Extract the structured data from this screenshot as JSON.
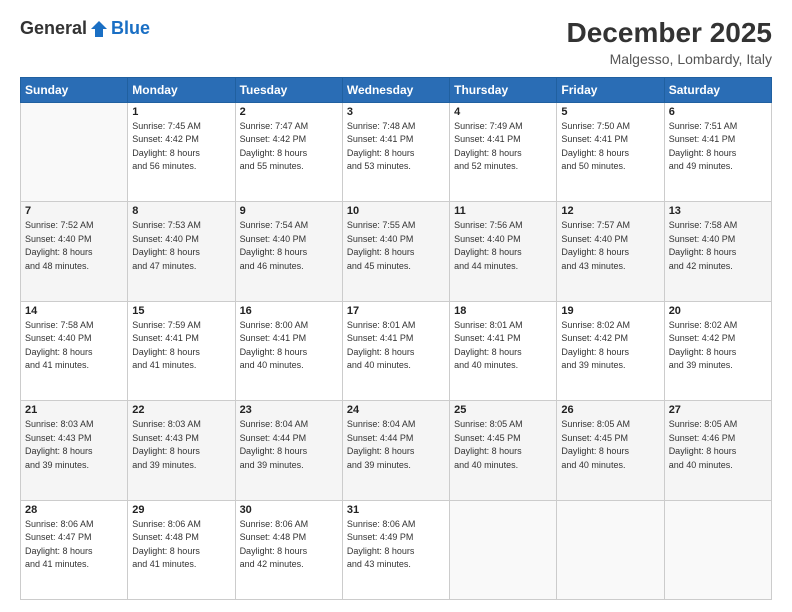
{
  "header": {
    "logo_general": "General",
    "logo_blue": "Blue",
    "month": "December 2025",
    "location": "Malgesso, Lombardy, Italy"
  },
  "days_of_week": [
    "Sunday",
    "Monday",
    "Tuesday",
    "Wednesday",
    "Thursday",
    "Friday",
    "Saturday"
  ],
  "weeks": [
    [
      {
        "day": "",
        "info": ""
      },
      {
        "day": "1",
        "info": "Sunrise: 7:45 AM\nSunset: 4:42 PM\nDaylight: 8 hours\nand 56 minutes."
      },
      {
        "day": "2",
        "info": "Sunrise: 7:47 AM\nSunset: 4:42 PM\nDaylight: 8 hours\nand 55 minutes."
      },
      {
        "day": "3",
        "info": "Sunrise: 7:48 AM\nSunset: 4:41 PM\nDaylight: 8 hours\nand 53 minutes."
      },
      {
        "day": "4",
        "info": "Sunrise: 7:49 AM\nSunset: 4:41 PM\nDaylight: 8 hours\nand 52 minutes."
      },
      {
        "day": "5",
        "info": "Sunrise: 7:50 AM\nSunset: 4:41 PM\nDaylight: 8 hours\nand 50 minutes."
      },
      {
        "day": "6",
        "info": "Sunrise: 7:51 AM\nSunset: 4:41 PM\nDaylight: 8 hours\nand 49 minutes."
      }
    ],
    [
      {
        "day": "7",
        "info": "Sunrise: 7:52 AM\nSunset: 4:40 PM\nDaylight: 8 hours\nand 48 minutes."
      },
      {
        "day": "8",
        "info": "Sunrise: 7:53 AM\nSunset: 4:40 PM\nDaylight: 8 hours\nand 47 minutes."
      },
      {
        "day": "9",
        "info": "Sunrise: 7:54 AM\nSunset: 4:40 PM\nDaylight: 8 hours\nand 46 minutes."
      },
      {
        "day": "10",
        "info": "Sunrise: 7:55 AM\nSunset: 4:40 PM\nDaylight: 8 hours\nand 45 minutes."
      },
      {
        "day": "11",
        "info": "Sunrise: 7:56 AM\nSunset: 4:40 PM\nDaylight: 8 hours\nand 44 minutes."
      },
      {
        "day": "12",
        "info": "Sunrise: 7:57 AM\nSunset: 4:40 PM\nDaylight: 8 hours\nand 43 minutes."
      },
      {
        "day": "13",
        "info": "Sunrise: 7:58 AM\nSunset: 4:40 PM\nDaylight: 8 hours\nand 42 minutes."
      }
    ],
    [
      {
        "day": "14",
        "info": "Sunrise: 7:58 AM\nSunset: 4:40 PM\nDaylight: 8 hours\nand 41 minutes."
      },
      {
        "day": "15",
        "info": "Sunrise: 7:59 AM\nSunset: 4:41 PM\nDaylight: 8 hours\nand 41 minutes."
      },
      {
        "day": "16",
        "info": "Sunrise: 8:00 AM\nSunset: 4:41 PM\nDaylight: 8 hours\nand 40 minutes."
      },
      {
        "day": "17",
        "info": "Sunrise: 8:01 AM\nSunset: 4:41 PM\nDaylight: 8 hours\nand 40 minutes."
      },
      {
        "day": "18",
        "info": "Sunrise: 8:01 AM\nSunset: 4:41 PM\nDaylight: 8 hours\nand 40 minutes."
      },
      {
        "day": "19",
        "info": "Sunrise: 8:02 AM\nSunset: 4:42 PM\nDaylight: 8 hours\nand 39 minutes."
      },
      {
        "day": "20",
        "info": "Sunrise: 8:02 AM\nSunset: 4:42 PM\nDaylight: 8 hours\nand 39 minutes."
      }
    ],
    [
      {
        "day": "21",
        "info": "Sunrise: 8:03 AM\nSunset: 4:43 PM\nDaylight: 8 hours\nand 39 minutes."
      },
      {
        "day": "22",
        "info": "Sunrise: 8:03 AM\nSunset: 4:43 PM\nDaylight: 8 hours\nand 39 minutes."
      },
      {
        "day": "23",
        "info": "Sunrise: 8:04 AM\nSunset: 4:44 PM\nDaylight: 8 hours\nand 39 minutes."
      },
      {
        "day": "24",
        "info": "Sunrise: 8:04 AM\nSunset: 4:44 PM\nDaylight: 8 hours\nand 39 minutes."
      },
      {
        "day": "25",
        "info": "Sunrise: 8:05 AM\nSunset: 4:45 PM\nDaylight: 8 hours\nand 40 minutes."
      },
      {
        "day": "26",
        "info": "Sunrise: 8:05 AM\nSunset: 4:45 PM\nDaylight: 8 hours\nand 40 minutes."
      },
      {
        "day": "27",
        "info": "Sunrise: 8:05 AM\nSunset: 4:46 PM\nDaylight: 8 hours\nand 40 minutes."
      }
    ],
    [
      {
        "day": "28",
        "info": "Sunrise: 8:06 AM\nSunset: 4:47 PM\nDaylight: 8 hours\nand 41 minutes."
      },
      {
        "day": "29",
        "info": "Sunrise: 8:06 AM\nSunset: 4:48 PM\nDaylight: 8 hours\nand 41 minutes."
      },
      {
        "day": "30",
        "info": "Sunrise: 8:06 AM\nSunset: 4:48 PM\nDaylight: 8 hours\nand 42 minutes."
      },
      {
        "day": "31",
        "info": "Sunrise: 8:06 AM\nSunset: 4:49 PM\nDaylight: 8 hours\nand 43 minutes."
      },
      {
        "day": "",
        "info": ""
      },
      {
        "day": "",
        "info": ""
      },
      {
        "day": "",
        "info": ""
      }
    ]
  ]
}
